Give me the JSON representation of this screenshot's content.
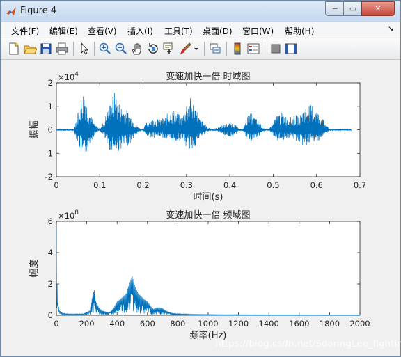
{
  "window": {
    "title": "Figure 4",
    "buttons": {
      "minimize": "─",
      "maximize": "▭",
      "close": "✕"
    }
  },
  "menu": {
    "items": [
      "文件(F)",
      "编辑(E)",
      "查看(V)",
      "插入(I)",
      "工具(T)",
      "桌面(D)",
      "窗口(W)",
      "帮助(H)"
    ],
    "overflow": "↘"
  },
  "toolbar": {
    "icons": [
      "new-figure-icon",
      "open-file-icon",
      "save-icon",
      "print-icon",
      "edit-plot-arrow-icon",
      "zoom-in-icon",
      "zoom-out-icon",
      "pan-hand-icon",
      "rotate-3d-icon",
      "data-cursor-icon",
      "brush-icon",
      "brush-dropdown-icon",
      "link-plot-icon",
      "colorbar-icon",
      "legend-icon",
      "hide-plot-tools-icon",
      "show-plot-tools-icon"
    ]
  },
  "chart_data": [
    {
      "type": "line",
      "title": "变速加快一倍 时域图",
      "xlabel": "时间(s)",
      "ylabel": "振幅",
      "exponent_label": "×10",
      "exponent_power": "4",
      "xlim": [
        0,
        0.7
      ],
      "ylim": [
        -2,
        2
      ],
      "xticks": [
        "0",
        "0.1",
        "0.2",
        "0.3",
        "0.4",
        "0.5",
        "0.6",
        "0.7"
      ],
      "yticks": [
        "-2",
        "-1",
        "0",
        "1",
        "2"
      ],
      "color": "#0072bd",
      "envelope": {
        "x": [
          0,
          0.04,
          0.05,
          0.06,
          0.065,
          0.07,
          0.08,
          0.09,
          0.1,
          0.11,
          0.12,
          0.13,
          0.135,
          0.14,
          0.15,
          0.16,
          0.17,
          0.18,
          0.19,
          0.2,
          0.21,
          0.22,
          0.24,
          0.25,
          0.26,
          0.27,
          0.28,
          0.29,
          0.3,
          0.31,
          0.32,
          0.33,
          0.34,
          0.35,
          0.36,
          0.37,
          0.38,
          0.39,
          0.4,
          0.41,
          0.42,
          0.43,
          0.44,
          0.45,
          0.46,
          0.47,
          0.48,
          0.49,
          0.5,
          0.51,
          0.52,
          0.53,
          0.54,
          0.55,
          0.56,
          0.57,
          0.58,
          0.59,
          0.6,
          0.61,
          0.62,
          0.63,
          0.64,
          0.66,
          0.68
        ],
        "upper": [
          0.02,
          0.05,
          0.8,
          1.6,
          1.8,
          1.2,
          0.6,
          0.2,
          0.05,
          0.4,
          1.0,
          1.5,
          1.65,
          1.4,
          1.0,
          0.9,
          0.7,
          0.3,
          0.1,
          0.03,
          0.4,
          0.5,
          0.45,
          0.55,
          0.8,
          0.85,
          0.7,
          0.55,
          1.2,
          1.4,
          1.1,
          0.5,
          0.3,
          0.1,
          0.05,
          0.08,
          0.2,
          0.25,
          0.3,
          0.3,
          0.05,
          0.05,
          0.6,
          0.75,
          0.5,
          0.3,
          0.05,
          0.05,
          0.3,
          0.7,
          0.75,
          0.6,
          0.55,
          0.6,
          0.7,
          0.9,
          1.1,
          1.1,
          0.85,
          0.6,
          0.3,
          0.05,
          0.02,
          0.02,
          0.02
        ],
        "lower": [
          -0.02,
          -0.05,
          -0.6,
          -1.2,
          -1.4,
          -0.9,
          -0.5,
          -0.15,
          -0.05,
          -0.3,
          -0.9,
          -0.85,
          -0.9,
          -1.0,
          -0.8,
          -0.75,
          -0.6,
          -0.3,
          -0.1,
          -0.03,
          -0.3,
          -0.35,
          -0.3,
          -0.4,
          -0.5,
          -0.55,
          -0.5,
          -0.4,
          -0.8,
          -0.9,
          -0.7,
          -0.4,
          -0.2,
          -0.08,
          -0.05,
          -0.05,
          -0.15,
          -0.25,
          -0.3,
          -0.3,
          -0.05,
          -0.05,
          -0.45,
          -0.5,
          -0.4,
          -0.25,
          -0.05,
          -0.05,
          -0.25,
          -0.5,
          -0.45,
          -0.4,
          -0.35,
          -0.45,
          -0.55,
          -0.7,
          -0.65,
          -0.55,
          -0.5,
          -0.4,
          -0.2,
          -0.05,
          -0.02,
          -0.02,
          -0.02
        ]
      }
    },
    {
      "type": "line",
      "title": "变速加快一倍 频域图",
      "xlabel": "频率(Hz)",
      "ylabel": "幅度",
      "exponent_label": "×10",
      "exponent_power": "8",
      "xlim": [
        0,
        2000
      ],
      "ylim": [
        0,
        6
      ],
      "xticks": [
        "0",
        "200",
        "400",
        "600",
        "800",
        "1000",
        "1200",
        "1400",
        "1600",
        "1800",
        "2000"
      ],
      "yticks": [
        "0",
        "2",
        "4",
        "6"
      ],
      "color": "#0072bd",
      "envelope": {
        "x": [
          0,
          5,
          10,
          20,
          40,
          80,
          120,
          180,
          220,
          230,
          240,
          250,
          260,
          280,
          300,
          320,
          340,
          360,
          380,
          400,
          420,
          440,
          460,
          480,
          500,
          510,
          520,
          540,
          560,
          580,
          600,
          620,
          640,
          660,
          680,
          700,
          720,
          760,
          800,
          900,
          1000,
          1100,
          1200,
          1400,
          1600,
          1800,
          2000
        ],
        "upper": [
          5.5,
          2.0,
          0.8,
          0.3,
          0.15,
          0.08,
          0.08,
          0.1,
          0.3,
          0.8,
          1.4,
          1.6,
          0.9,
          0.5,
          0.3,
          0.25,
          0.2,
          0.25,
          0.5,
          0.9,
          1.0,
          1.2,
          1.4,
          2.0,
          2.5,
          2.1,
          1.8,
          1.4,
          1.2,
          1.0,
          0.9,
          0.6,
          0.4,
          0.5,
          0.5,
          0.45,
          0.3,
          0.15,
          0.1,
          0.06,
          0.05,
          0.04,
          0.04,
          0.03,
          0.03,
          0.02,
          0.02
        ]
      }
    }
  ],
  "watermark": "https://blog.csdn.net/SoaringLee_fighting"
}
